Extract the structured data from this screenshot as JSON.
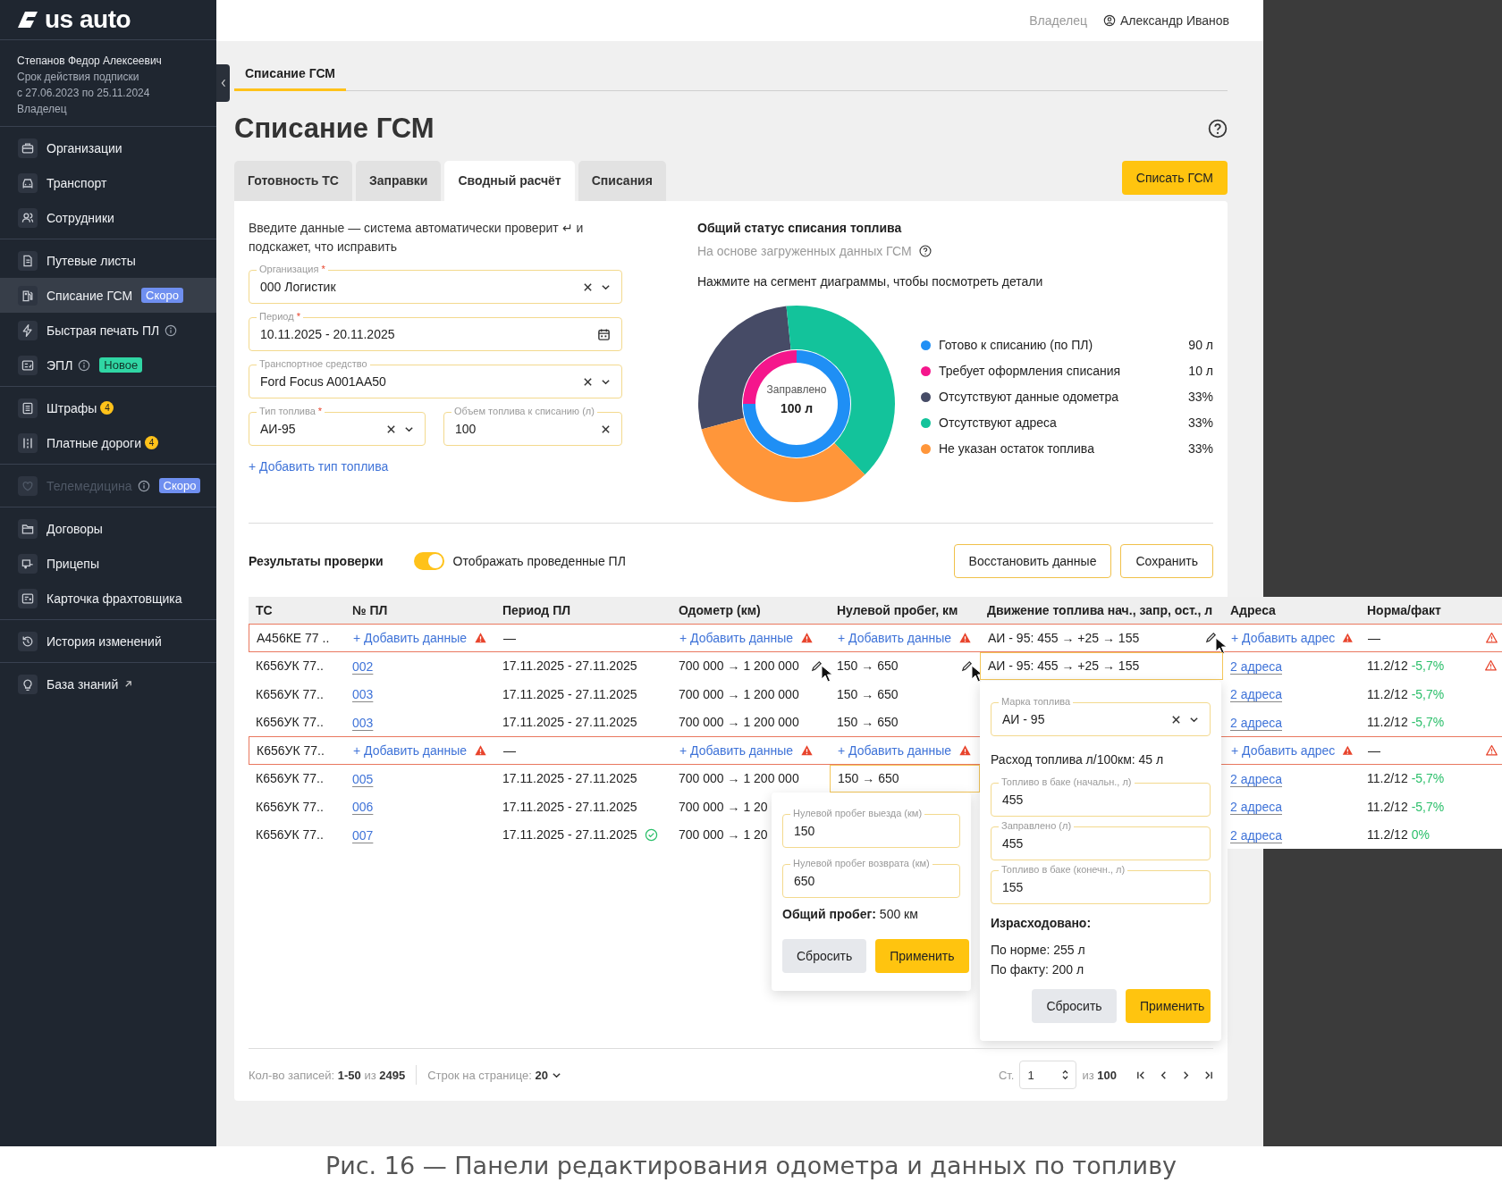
{
  "sidebar": {
    "logo": "us auto",
    "user": {
      "name": "Степанов Федор Алексеевич",
      "subscription_label": "Срок действия подписки",
      "subscription_period": "с 27.06.2023 по 25.11.2024",
      "role": "Владелец"
    },
    "groups": [
      {
        "items": [
          {
            "label": "Организации",
            "selected": false,
            "disabled": false
          },
          {
            "label": "Транспорт",
            "selected": false,
            "disabled": false
          },
          {
            "label": "Сотрудники",
            "selected": false,
            "disabled": false
          }
        ]
      },
      {
        "items": [
          {
            "label": "Путевые листы",
            "selected": false,
            "disabled": false
          },
          {
            "label": "Списание ГСМ",
            "selected": true,
            "disabled": false,
            "badge": {
              "kind": "soon",
              "text": "Скоро"
            }
          },
          {
            "label": "Быстрая печать ПЛ",
            "selected": false,
            "disabled": false,
            "info": true
          },
          {
            "label": "ЭПЛ",
            "selected": false,
            "disabled": false,
            "info": true,
            "badge": {
              "kind": "new",
              "text": "Новое"
            }
          }
        ]
      },
      {
        "items": [
          {
            "label": "Штрафы",
            "selected": false,
            "disabled": false,
            "badge": {
              "kind": "count",
              "text": "4"
            }
          },
          {
            "label": "Платные дороги",
            "selected": false,
            "disabled": false,
            "badge": {
              "kind": "count",
              "text": "4"
            }
          }
        ]
      },
      {
        "items": [
          {
            "label": "Телемедицина",
            "selected": false,
            "disabled": true,
            "info": true,
            "badge": {
              "kind": "soon",
              "text": "Скоро"
            }
          }
        ]
      },
      {
        "items": [
          {
            "label": "Договоры",
            "selected": false,
            "disabled": false
          },
          {
            "label": "Прицепы",
            "selected": false,
            "disabled": false
          },
          {
            "label": "Карточка фрахтовщика",
            "selected": false,
            "disabled": false
          }
        ]
      },
      {
        "items": [
          {
            "label": "История изменений",
            "selected": false,
            "disabled": false
          }
        ]
      },
      {
        "items": [
          {
            "label": "База знаний",
            "selected": false,
            "disabled": false,
            "external": true
          }
        ]
      }
    ]
  },
  "header": {
    "role": "Владелец",
    "user_name": "Александр Иванов"
  },
  "breadcrumb_tabs": [
    {
      "label": "Списание ГСМ",
      "selected": true
    }
  ],
  "page_title": "Списание ГСМ",
  "tabs": [
    {
      "label": "Готовность ТС",
      "selected": false
    },
    {
      "label": "Заправки",
      "selected": false
    },
    {
      "label": "Сводный расчёт",
      "selected": true
    },
    {
      "label": "Списания",
      "selected": false
    }
  ],
  "action_button": "Списать ГСМ",
  "form": {
    "intro": "Введите данные — система автоматически проверит ↵ и подскажет, что исправить",
    "fields": [
      {
        "label": "Организация",
        "required_mark": "*",
        "value": "000 Логистик",
        "kind": "select"
      },
      {
        "label": "Период",
        "required_mark": "*",
        "value": "10.11.2025 - 20.11.2025",
        "kind": "date"
      },
      {
        "label": "Транспортное средство",
        "value": "Ford Focus A001AA50",
        "kind": "select"
      },
      {
        "label": "Тип топлива",
        "required_mark": "*",
        "value": "АИ-95",
        "kind": "select"
      },
      {
        "label": "Объем топлива к списанию (л)",
        "value": "100",
        "kind": "clearable"
      }
    ],
    "add_link": "+ Добавить тип топлива"
  },
  "status": {
    "title": "Общий статус списания топлива",
    "subtitle": "На основе загруженных данных ГСМ",
    "hint": "Нажмите на сегмент диаграммы, чтобы посмотреть детали",
    "center_label": "Заправлено",
    "center_value": "100 л",
    "legend": [
      {
        "label": "Готово к списанию (по ПЛ)",
        "value": "90 л",
        "color": "#1f8ff5"
      },
      {
        "label": "Требует оформления списания",
        "value": "10 л",
        "color": "#f5168c"
      },
      {
        "label": "Отсутствуют данные одометра",
        "value": "33%",
        "color": "#464b66"
      },
      {
        "label": "Отсутствуют адреса",
        "value": "33%",
        "color": "#13c39b"
      },
      {
        "label": "Не указан остаток топлива",
        "value": "33%",
        "color": "#ff963a"
      }
    ]
  },
  "results": {
    "title": "Результаты проверки",
    "toggle": {
      "label": "Отображать проведенные ПЛ",
      "on": true
    },
    "buttons": [
      "Восстановить данные",
      "Сохранить"
    ]
  },
  "table": {
    "columns": [
      "ТС",
      "№ ПЛ",
      "Период ПЛ",
      "Одометр (км)",
      "Нулевой пробег, км",
      "Движение топлива нач., запр, ост., л",
      "Адреса",
      "Норма/факт"
    ],
    "rows": [
      {
        "error": true,
        "warning": true,
        "cells": [
          {
            "kind": "plain",
            "text": "А456КЕ 77 .."
          },
          {
            "kind": "add",
            "text": "+ Добавить данные",
            "alert": true
          },
          {
            "kind": "plain",
            "text": "—"
          },
          {
            "kind": "add",
            "text": "+ Добавить данные",
            "alert": true
          },
          {
            "kind": "add",
            "text": "+ Добавить данные",
            "alert": true
          },
          {
            "kind": "plain",
            "text": "АИ - 95: 455 → +25 → 155",
            "editable": true,
            "cursor": true
          },
          {
            "kind": "add",
            "text": "+ Добавить адрес",
            "alert": true
          },
          {
            "kind": "plain",
            "text": "—"
          }
        ]
      },
      {
        "error": false,
        "warning": true,
        "cells": [
          {
            "kind": "plain",
            "text": "К656УК 77.."
          },
          {
            "kind": "link",
            "text": "002"
          },
          {
            "kind": "plain",
            "text": "17.11.2025 - 27.11.2025"
          },
          {
            "kind": "plain",
            "text": "700 000 → 1 200 000",
            "editable": true,
            "cursor": true
          },
          {
            "kind": "plain",
            "text": "150 → 650",
            "editable": true,
            "cursor": true
          },
          {
            "kind": "plain",
            "text": "АИ - 95: 455 → +25 → 155",
            "highlighted": true
          },
          {
            "kind": "link",
            "text": "2 адреса"
          },
          {
            "kind": "plain",
            "text": "11.2/12",
            "delta": "-5,7%"
          }
        ]
      },
      {
        "error": false,
        "warning": false,
        "cells": [
          {
            "kind": "plain",
            "text": "К656УК 77.."
          },
          {
            "kind": "link",
            "text": "003"
          },
          {
            "kind": "plain",
            "text": "17.11.2025 - 27.11.2025"
          },
          {
            "kind": "plain",
            "text": "700 000 → 1 200 000"
          },
          {
            "kind": "plain",
            "text": "150 → 650"
          },
          {
            "kind": "hidden"
          },
          {
            "kind": "link",
            "text": "2 адреса"
          },
          {
            "kind": "plain",
            "text": "11.2/12",
            "delta": "-5,7%"
          }
        ]
      },
      {
        "error": false,
        "warning": false,
        "cells": [
          {
            "kind": "plain",
            "text": "К656УК 77.."
          },
          {
            "kind": "link",
            "text": "003"
          },
          {
            "kind": "plain",
            "text": "17.11.2025 - 27.11.2025"
          },
          {
            "kind": "plain",
            "text": "700 000 → 1 200 000"
          },
          {
            "kind": "plain",
            "text": "150 → 650"
          },
          {
            "kind": "hidden"
          },
          {
            "kind": "link",
            "text": "2 адреса"
          },
          {
            "kind": "plain",
            "text": "11.2/12",
            "delta": "-5,7%"
          }
        ]
      },
      {
        "error": true,
        "warning": true,
        "cells": [
          {
            "kind": "plain",
            "text": "К656УК 77.."
          },
          {
            "kind": "add",
            "text": "+ Добавить данные",
            "alert": true
          },
          {
            "kind": "plain",
            "text": "—"
          },
          {
            "kind": "add",
            "text": "+ Добавить данные",
            "alert": true
          },
          {
            "kind": "add",
            "text": "+ Добавить данные",
            "alert": true
          },
          {
            "kind": "hidden"
          },
          {
            "kind": "add",
            "text": "+ Добавить адрес",
            "alert": true
          },
          {
            "kind": "plain",
            "text": "—"
          }
        ]
      },
      {
        "error": false,
        "warning": false,
        "cells": [
          {
            "kind": "plain",
            "text": "К656УК 77.."
          },
          {
            "kind": "link",
            "text": "005"
          },
          {
            "kind": "plain",
            "text": "17.11.2025 - 27.11.2025"
          },
          {
            "kind": "plain",
            "text": "700 000 → 1 200 000"
          },
          {
            "kind": "plain",
            "text": "150 → 650",
            "highlighted": true
          },
          {
            "kind": "hidden"
          },
          {
            "kind": "link",
            "text": "2 адреса"
          },
          {
            "kind": "plain",
            "text": "11.2/12",
            "delta": "-5,7%"
          }
        ]
      },
      {
        "error": false,
        "warning": false,
        "cells": [
          {
            "kind": "plain",
            "text": "К656УК 77.."
          },
          {
            "kind": "link",
            "text": "006"
          },
          {
            "kind": "plain",
            "text": "17.11.2025 - 27.11.2025"
          },
          {
            "kind": "plain",
            "text": "700 000 → 1 20"
          },
          {
            "kind": "hidden"
          },
          {
            "kind": "hidden"
          },
          {
            "kind": "link",
            "text": "2 адреса"
          },
          {
            "kind": "plain",
            "text": "11.2/12",
            "delta": "-5,7%"
          }
        ]
      },
      {
        "error": false,
        "warning": false,
        "cells": [
          {
            "kind": "plain",
            "text": "К656УК 77.."
          },
          {
            "kind": "link",
            "text": "007"
          },
          {
            "kind": "plain",
            "text": "17.11.2025 - 27.11.2025",
            "ok": true
          },
          {
            "kind": "plain",
            "text": "700 000 → 1 20"
          },
          {
            "kind": "hidden"
          },
          {
            "kind": "hidden"
          },
          {
            "kind": "link",
            "text": "2 адреса"
          },
          {
            "kind": "plain",
            "text": "11.2/12",
            "delta": "0%"
          }
        ]
      }
    ]
  },
  "odometer_editor": {
    "fields": [
      {
        "label": "Нулевой пробег выезда (км)",
        "value": "150"
      },
      {
        "label": "Нулевой пробег возврата (км)",
        "value": "650"
      }
    ],
    "total": "**Общий пробег:** 500 км",
    "buttons": [
      {
        "label": "Сбросить",
        "kind": "secondary"
      },
      {
        "label": "Применить",
        "kind": "primary"
      }
    ]
  },
  "fuel_editor": {
    "items": [
      {
        "kind": "select",
        "label": "Марка топлива",
        "value": "АИ - 95"
      },
      {
        "kind": "text",
        "text": "Расход топлива л/100км: 45 л"
      },
      {
        "kind": "input",
        "label": "Топливо в баке (начальн., л)",
        "value": "455"
      },
      {
        "kind": "input",
        "label": "Заправлено (л)",
        "value": "455"
      },
      {
        "kind": "input",
        "label": "Топливо в баке (конечн., л)",
        "value": "155"
      },
      {
        "kind": "heading",
        "text": "Израсходовано:"
      },
      {
        "kind": "line",
        "text": "По норме: 255 л"
      },
      {
        "kind": "line",
        "text": "По факту: 200 л"
      }
    ],
    "buttons": [
      {
        "label": "Сбросить",
        "kind": "secondary"
      },
      {
        "label": "Применить",
        "kind": "primary"
      }
    ]
  },
  "footer": {
    "records_label": "Кол-во записей:",
    "records_value": "**1-50** из **2495**",
    "page_size_label": "Строк на странице:",
    "page_size": "20",
    "page_label": "Ст.",
    "page": "1",
    "page_total": "из **100**"
  },
  "caption": "Рис. 16 — Панели редактирования одометра и данных по топливу"
}
